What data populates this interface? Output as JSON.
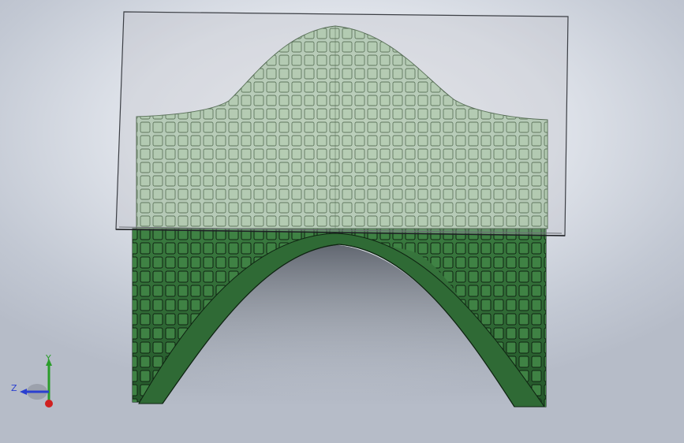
{
  "viewport": {
    "background_top": "#f3f5f9",
    "background_bottom": "#b6bcc8"
  },
  "model": {
    "body_color": "#2f6a35",
    "body_edge_color": "#0f2412",
    "tile_color": "#3b7a3f",
    "translucent_surface_color": "#8fbf85",
    "sketch_plane_color": "#b9bcc2"
  },
  "triad": {
    "y_label": "Y",
    "z_label": "Z",
    "x_color": "#d02020",
    "y_color": "#2a9d2a",
    "z_color": "#2a3fd0"
  }
}
